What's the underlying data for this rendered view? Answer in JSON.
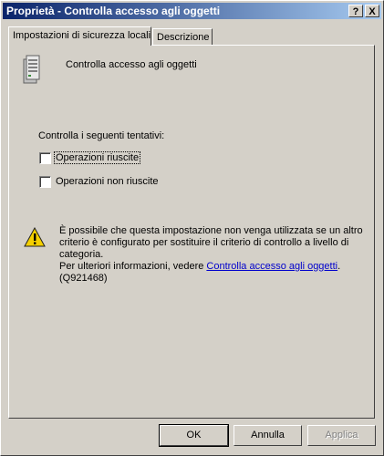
{
  "window": {
    "title": "Proprietà - Controlla accesso agli oggetti",
    "help_button": "?",
    "close_button": "X"
  },
  "tabs": [
    {
      "label": "Impostazioni di sicurezza locali",
      "active": true
    },
    {
      "label": "Descrizione",
      "active": false
    }
  ],
  "policy": {
    "icon": "server-policy-icon",
    "name": "Controlla accesso agli oggetti"
  },
  "audit": {
    "heading": "Controlla i seguenti tentativi:",
    "success": {
      "label": "Operazioni riuscite",
      "checked": false
    },
    "failure": {
      "label": "Operazioni non riuscite",
      "checked": false
    }
  },
  "warning": {
    "icon": "warning-icon",
    "line1": "È possibile che questa impostazione non venga utilizzata se un altro",
    "line2": "criterio è configurato per sostituire il criterio di controllo a livello di",
    "line3": "categoria.",
    "more_prefix": "Per ulteriori informazioni, vedere ",
    "link_text": "Controlla accesso agli oggetti",
    "more_suffix": ".",
    "kb": "(Q921468)"
  },
  "buttons": {
    "ok": "OK",
    "cancel": "Annulla",
    "apply": "Applica"
  },
  "colors": {
    "titlebar_start": "#0a246a",
    "titlebar_end": "#a6caf0",
    "face": "#d4d0c8",
    "link": "#0000cc"
  }
}
